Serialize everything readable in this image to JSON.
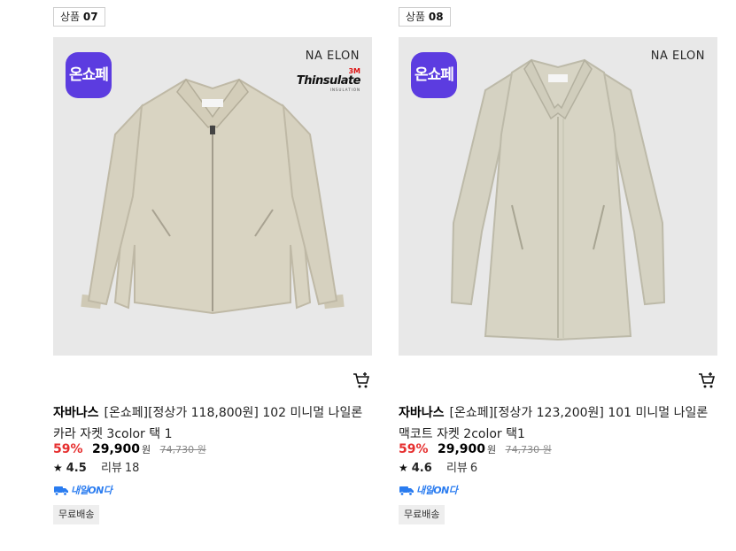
{
  "products": [
    {
      "rank_label": "상품",
      "rank_num": "07",
      "badge": "온쇼페",
      "brand_mark": "NA ELON",
      "insulation": {
        "maker": "3M",
        "name": "Thinsulate",
        "sub": "INSULATION"
      },
      "brand": "자바나스",
      "name": "[온쇼페][정상가 118,800원] 102 미니멀 나일론 카라 자켓 3color 택 1",
      "discount": "59%",
      "price": "29,900",
      "currency": "원",
      "original_price": "74,730 원",
      "rating": "4.5",
      "review_label": "리뷰",
      "review_count": "18",
      "delivery": "내일ON다",
      "free_shipping": "무료배송",
      "colors": {
        "garment": "#d9d4c2",
        "garment_shade": "#bfb9a6"
      }
    },
    {
      "rank_label": "상품",
      "rank_num": "08",
      "badge": "온쇼페",
      "brand_mark": "NA ELON",
      "brand": "자바나스",
      "name": "[온쇼페][정상가 123,200원] 101 미니멀 나일론 맥코트 자켓 2color 택1",
      "discount": "59%",
      "price": "29,900",
      "currency": "원",
      "original_price": "74,730 원",
      "rating": "4.6",
      "review_label": "리뷰",
      "review_count": "6",
      "delivery": "내일ON다",
      "free_shipping": "무료배송",
      "colors": {
        "garment": "#d7d4c4",
        "garment_shade": "#bdbaa9"
      }
    }
  ],
  "icons": {
    "cart": "cart-icon",
    "star": "star-icon",
    "truck": "truck-icon"
  },
  "theme": {
    "badge_bg": "#5c3ce0",
    "discount": "#e62f2f",
    "delivery": "#2a7cf0",
    "thumb_bg": "#e8e8e8"
  }
}
